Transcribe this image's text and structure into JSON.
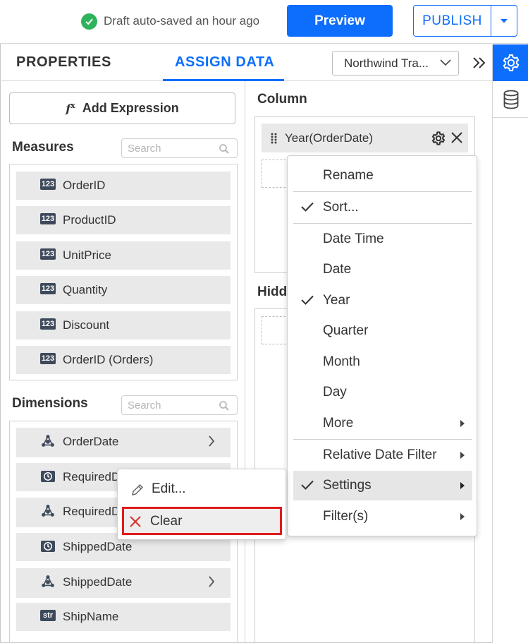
{
  "header": {
    "autosave_text": "Draft auto-saved an hour ago",
    "preview_label": "Preview",
    "publish_label": "PUBLISH"
  },
  "tabs": {
    "properties_label": "PROPERTIES",
    "assign_data_label": "ASSIGN DATA",
    "active": "ASSIGN DATA",
    "datasource_value": "Northwind Tra..."
  },
  "left_panel": {
    "add_expression_label": "Add Expression",
    "measures": {
      "title": "Measures",
      "search_placeholder": "Search",
      "items": [
        {
          "type_badge": "123",
          "label": "OrderID"
        },
        {
          "type_badge": "123",
          "label": "ProductID"
        },
        {
          "type_badge": "123",
          "label": "UnitPrice"
        },
        {
          "type_badge": "123",
          "label": "Quantity"
        },
        {
          "type_badge": "123",
          "label": "Discount"
        },
        {
          "type_badge": "123",
          "label": "OrderID (Orders)"
        }
      ]
    },
    "dimensions": {
      "title": "Dimensions",
      "search_placeholder": "Search",
      "items": [
        {
          "icon": "hierarchy-icon",
          "label": "OrderDate",
          "expandable": true
        },
        {
          "icon": "clock-icon",
          "label": "RequiredDa",
          "expandable": false
        },
        {
          "icon": "hierarchy-icon",
          "label": "RequiredDa",
          "expandable": false
        },
        {
          "icon": "clock-icon",
          "label": "ShippedDate",
          "expandable": false
        },
        {
          "icon": "hierarchy-icon",
          "label": "ShippedDate",
          "expandable": true
        },
        {
          "type_badge": "str",
          "label": "ShipName",
          "expandable": false
        }
      ]
    }
  },
  "right_panel": {
    "column_title": "Column",
    "column_chip_label": "Year(OrderDate)",
    "hidden_title": "Hidde"
  },
  "context_menu": {
    "items": [
      {
        "label": "Rename",
        "checked": false,
        "submenu": false
      },
      {
        "label": "Sort...",
        "checked": true,
        "submenu": false
      },
      {
        "label": "Date Time",
        "checked": false,
        "submenu": false
      },
      {
        "label": "Date",
        "checked": false,
        "submenu": false
      },
      {
        "label": "Year",
        "checked": true,
        "submenu": false
      },
      {
        "label": "Quarter",
        "checked": false,
        "submenu": false
      },
      {
        "label": "Month",
        "checked": false,
        "submenu": false
      },
      {
        "label": "Day",
        "checked": false,
        "submenu": false
      },
      {
        "label": "More",
        "checked": false,
        "submenu": true
      },
      {
        "label": "Relative Date Filter",
        "checked": false,
        "submenu": true
      },
      {
        "label": "Settings",
        "checked": true,
        "submenu": true,
        "highlighted": true
      },
      {
        "label": "Filter(s)",
        "checked": false,
        "submenu": true
      }
    ]
  },
  "settings_popup": {
    "edit_label": "Edit...",
    "clear_label": "Clear"
  },
  "colors": {
    "accent": "#0d6efd",
    "success": "#2eb35a",
    "highlight_border": "#e21b1b",
    "chip_bg": "#e9e9e9"
  }
}
